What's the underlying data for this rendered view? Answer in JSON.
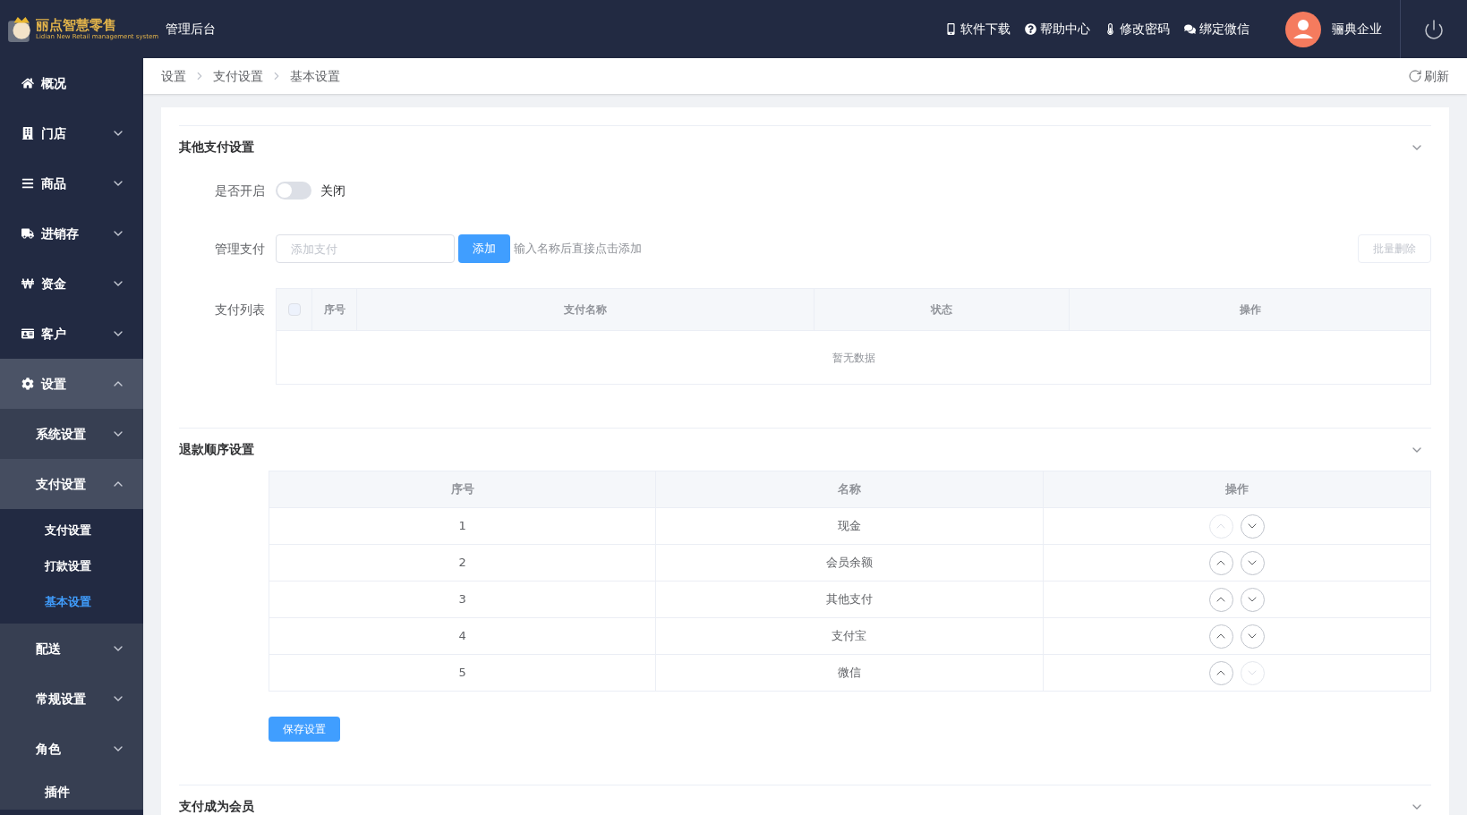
{
  "header": {
    "logo": {
      "name": "丽点智慧零售",
      "subtitle": "Lidian New Retail management system"
    },
    "title": "管理后台",
    "links": [
      {
        "label": "软件下载"
      },
      {
        "label": "帮助中心"
      },
      {
        "label": "修改密码"
      },
      {
        "label": "绑定微信"
      }
    ],
    "user": {
      "name": "骊典企业"
    }
  },
  "sidebar": {
    "items": [
      {
        "label": "概况",
        "selected": false
      },
      {
        "label": "门店",
        "selected": false,
        "expanded": false
      },
      {
        "label": "商品",
        "selected": false,
        "expanded": false
      },
      {
        "label": "进销存",
        "selected": false,
        "expanded": false
      },
      {
        "label": "资金",
        "selected": false,
        "expanded": false
      },
      {
        "label": "客户",
        "selected": false,
        "expanded": false
      },
      {
        "label": "设置",
        "selected": false,
        "expanded": true,
        "children": [
          {
            "label": "系统设置",
            "selected": false,
            "expanded": false
          },
          {
            "label": "支付设置",
            "selected": false,
            "expanded": true,
            "children": [
              {
                "label": "支付设置",
                "selected": false
              },
              {
                "label": "打款设置",
                "selected": false
              },
              {
                "label": "基本设置",
                "selected": true
              }
            ]
          },
          {
            "label": "配送",
            "selected": false,
            "expanded": false
          },
          {
            "label": "常规设置",
            "selected": false,
            "expanded": false
          },
          {
            "label": "角色",
            "selected": false,
            "expanded": false
          },
          {
            "label": "插件",
            "selected": false
          }
        ]
      }
    ]
  },
  "breadcrumb": {
    "items": [
      "设置",
      "支付设置",
      "基本设置"
    ],
    "refresh": "刷新"
  },
  "sections": [
    {
      "kind": "other_payment",
      "title": "其他支付设置",
      "expanded": true,
      "enable": {
        "label": "是否开启",
        "on": false,
        "state_text": "关闭"
      },
      "manage": {
        "label": "管理支付",
        "placeholder": "添加支付",
        "add_button": "添加",
        "hint": "输入名称后直接点击添加",
        "batch_delete": {
          "label": "批量删除",
          "disabled": true
        }
      },
      "list": {
        "label": "支付列表",
        "all_checked": false,
        "columns": [
          "序号",
          "支付名称",
          "状态",
          "操作"
        ],
        "empty_text": "暂无数据"
      }
    },
    {
      "kind": "refund_order",
      "title": "退款顺序设置",
      "expanded": true,
      "columns": [
        "序号",
        "名称",
        "操作"
      ],
      "rows": [
        {
          "index": "1",
          "name": "现金",
          "up_disabled": true,
          "down_disabled": false
        },
        {
          "index": "2",
          "name": "会员余额",
          "up_disabled": false,
          "down_disabled": false
        },
        {
          "index": "3",
          "name": "其他支付",
          "up_disabled": false,
          "down_disabled": false
        },
        {
          "index": "4",
          "name": "支付宝",
          "up_disabled": false,
          "down_disabled": false
        },
        {
          "index": "5",
          "name": "微信",
          "up_disabled": false,
          "down_disabled": true
        }
      ],
      "save_button": "保存设置"
    },
    {
      "kind": "member",
      "title": "支付成为会员",
      "expanded": true
    }
  ]
}
